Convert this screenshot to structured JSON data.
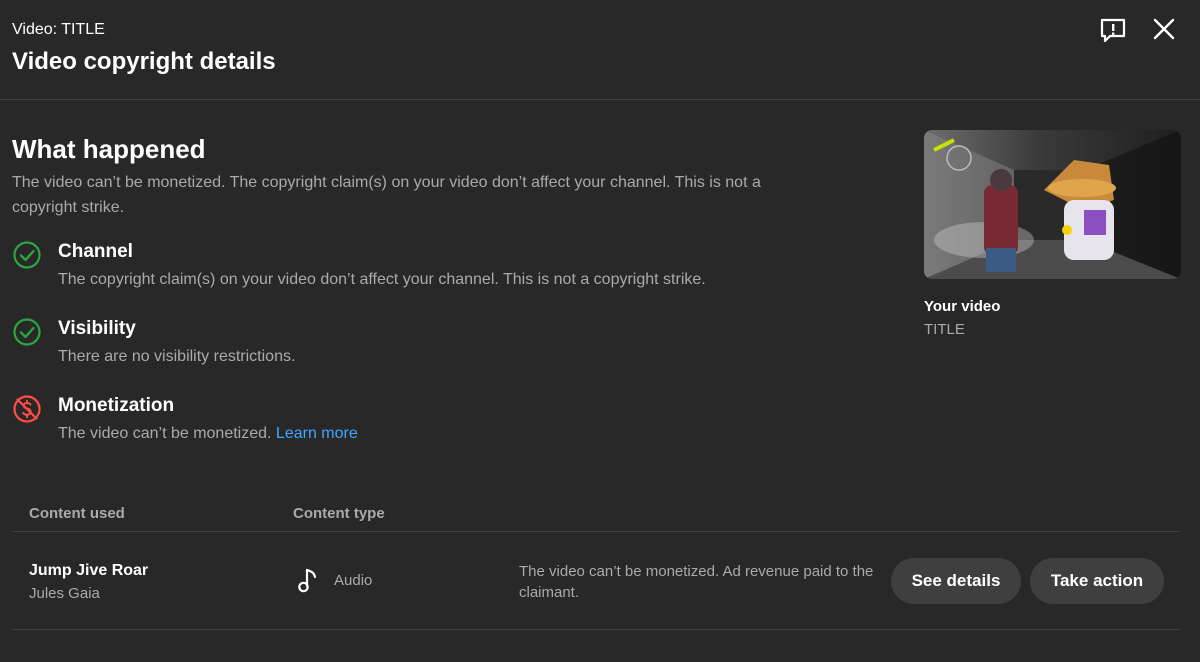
{
  "header": {
    "subtitle": "Video: TITLE",
    "title": "Video copyright details",
    "feedback_icon": "feedback-icon",
    "close_icon": "close-icon"
  },
  "what_happened": {
    "title": "What happened",
    "description": "The video can’t be monetized. The copyright claim(s) on your video don’t affect your channel. This is not a copyright strike."
  },
  "statuses": [
    {
      "title": "Channel",
      "description": "The copyright claim(s) on your video don’t affect your channel. This is not a copyright strike.",
      "icon": "check-circle-icon",
      "color": "#2ba640"
    },
    {
      "title": "Visibility",
      "description": "There are no visibility restrictions.",
      "icon": "check-circle-icon",
      "color": "#2ba640"
    },
    {
      "title": "Monetization",
      "description": "The video can’t be monetized.",
      "link": "Learn more",
      "icon": "demonetized-icon",
      "color": "#ff4e45"
    }
  ],
  "video_card": {
    "label": "Your video",
    "title": "TITLE"
  },
  "table": {
    "headers": [
      "Content used",
      "Content type"
    ],
    "rows": [
      {
        "song": "Jump Jive Roar",
        "artist": "Jules Gaia",
        "type": "Audio",
        "type_icon": "music-note-icon",
        "status": "The video can’t be monetized. Ad revenue paid to the claimant.",
        "actions": [
          "See details",
          "Take action"
        ]
      }
    ]
  },
  "colors": {
    "background": "#282828",
    "link": "#3ea6ff",
    "button_bg": "#3f3f3f"
  }
}
